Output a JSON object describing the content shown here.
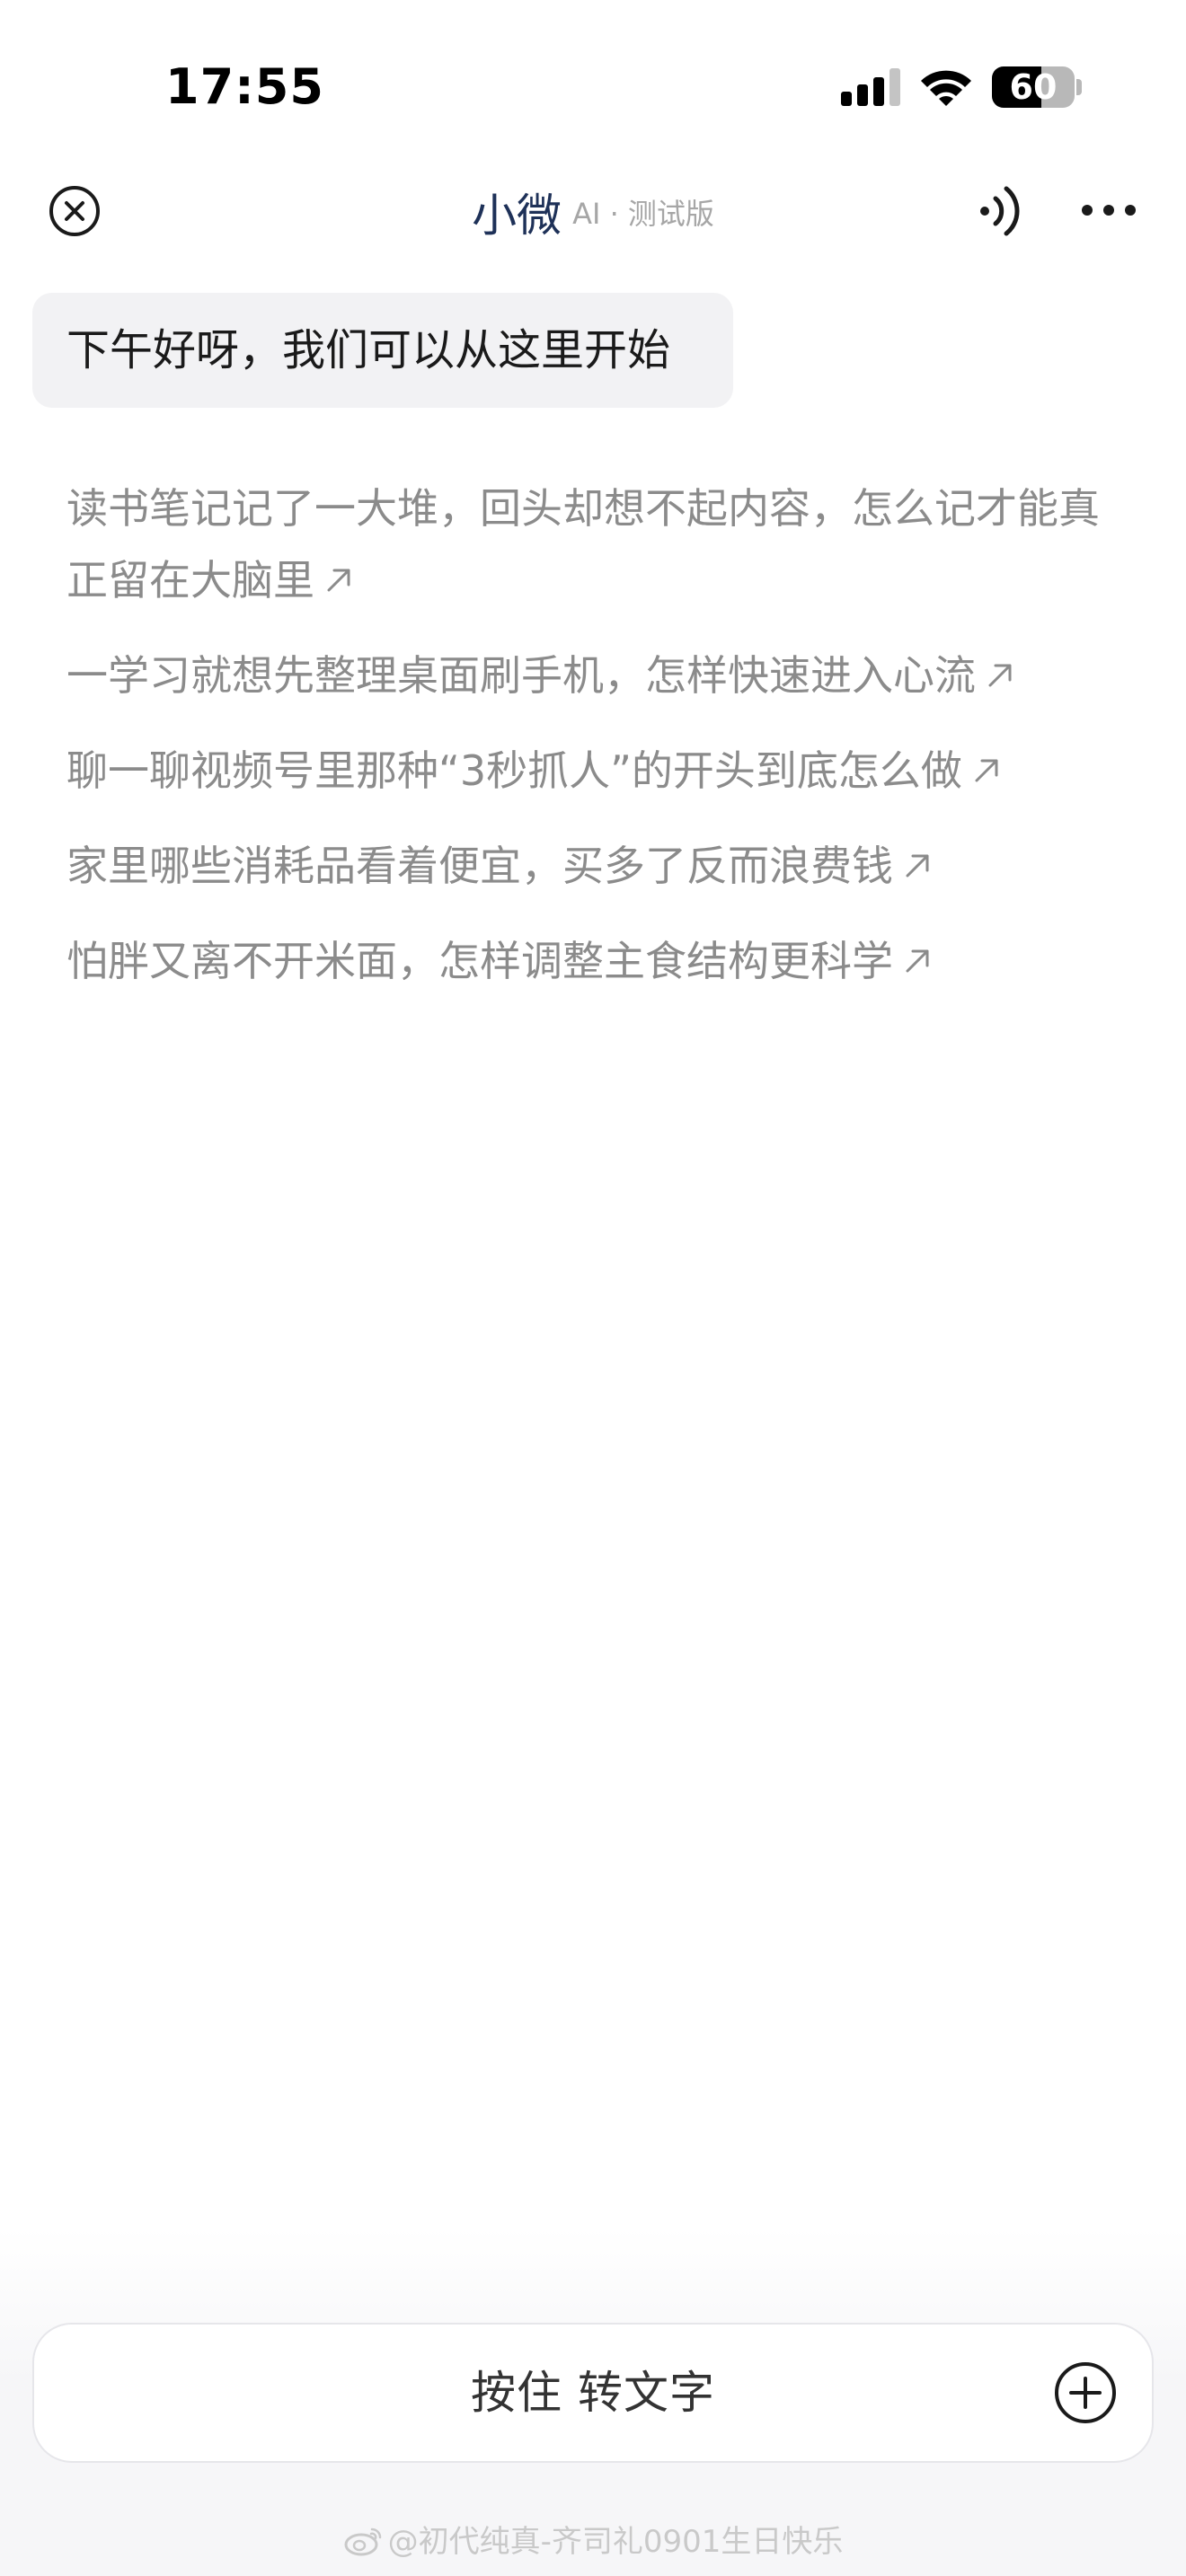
{
  "status_bar": {
    "time": "17:55",
    "battery": "60"
  },
  "header": {
    "title": "小微",
    "subtitle": "AI · 测试版"
  },
  "greeting": "下午好呀，我们可以从这里开始",
  "suggestions": [
    "读书笔记记了一大堆，回头却想不起内容，怎么记才能真正留在大脑里",
    "一学习就想先整理桌面刷手机，怎样快速进入心流",
    "聊一聊视频号里那种“3秒抓人”的开头到底怎么做",
    "家里哪些消耗品看着便宜，买多了反而浪费钱",
    "怕胖又离不开米面，怎样调整主食结构更科学"
  ],
  "input": {
    "label": "按住 转文字"
  },
  "watermark": "@初代纯真-齐司礼0901生日快乐",
  "colors": {
    "title": "#1e3158",
    "suggestion_text": "#8b8b8b",
    "bubble_bg": "#f2f2f4"
  }
}
